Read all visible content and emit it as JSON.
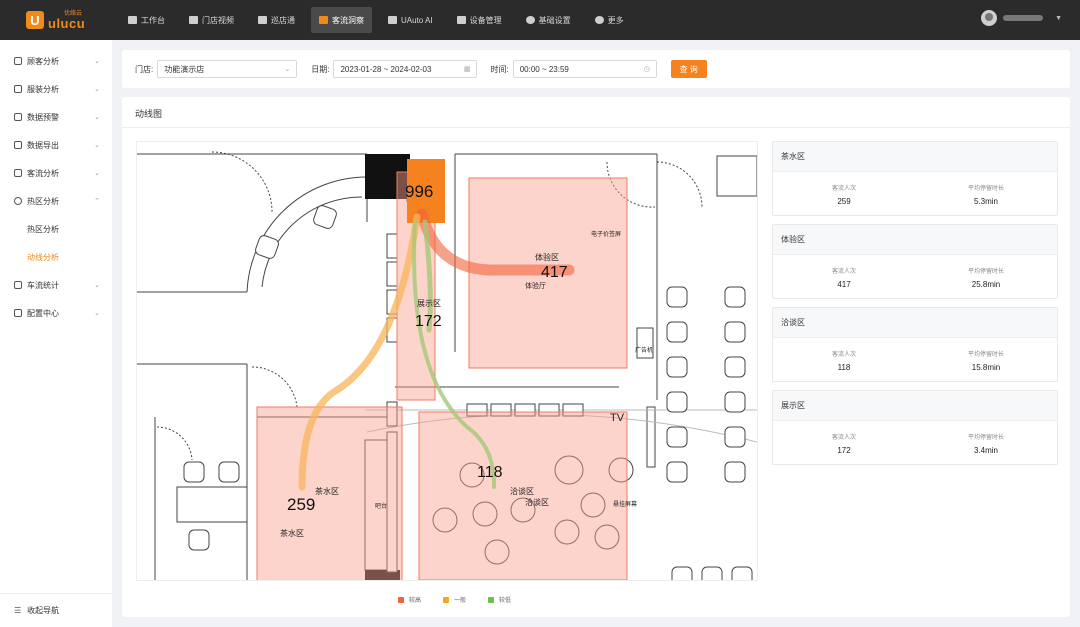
{
  "brand": {
    "name_cn": "优络云",
    "name_en": "ulucu",
    "color": "#f08a1b"
  },
  "topnav": [
    {
      "label": "工作台",
      "icon": "home-icon"
    },
    {
      "label": "门店视频",
      "icon": "video-icon"
    },
    {
      "label": "巡店通",
      "icon": "checklist-icon"
    },
    {
      "label": "客流洞察",
      "icon": "people-icon",
      "active": true
    },
    {
      "label": "UAuto AI",
      "icon": "ai-icon"
    },
    {
      "label": "设备管理",
      "icon": "device-icon"
    },
    {
      "label": "基础设置",
      "icon": "settings-icon"
    },
    {
      "label": "更多",
      "icon": "more-icon"
    }
  ],
  "sidebar": {
    "items": [
      {
        "label": "顾客分析",
        "icon": "user-icon"
      },
      {
        "label": "服装分析",
        "icon": "shirt-icon"
      },
      {
        "label": "数据预警",
        "icon": "bell-icon"
      },
      {
        "label": "数据导出",
        "icon": "export-icon"
      },
      {
        "label": "客流分析",
        "icon": "people-icon"
      },
      {
        "label": "热区分析",
        "icon": "target-icon"
      }
    ],
    "sub_items": [
      {
        "label": "热区分析"
      },
      {
        "label": "动线分析",
        "active": true
      }
    ],
    "items_after": [
      {
        "label": "车流统计",
        "icon": "car-icon"
      },
      {
        "label": "配置中心",
        "icon": "config-icon"
      }
    ],
    "collapse_label": "收起导航"
  },
  "filter": {
    "store_label": "门店:",
    "store_value": "功能演示店",
    "date_label": "日期:",
    "date_value": "2023-01-28  ~  2024-02-03",
    "time_label": "时间:",
    "time_value": "00:00  ~  23:59",
    "query_label": "查 询"
  },
  "panel": {
    "title": "动线图"
  },
  "map": {
    "entrance_count": "996",
    "zones": [
      {
        "name": "体验区",
        "count": "417",
        "sub_label": "体验厅"
      },
      {
        "name": "展示区",
        "count": "172"
      },
      {
        "name": "洽谈区",
        "count": "118",
        "sub_label": "洽谈区"
      },
      {
        "name": "茶水区",
        "count": "259",
        "sub_label": "茶水区"
      }
    ],
    "labels": {
      "tv": "TV",
      "ad": "广告机",
      "sign1": "电子价签屏",
      "sign2": "悬挂屏幕",
      "counter": "吧台"
    }
  },
  "legend": [
    {
      "label": "较高",
      "color": "#f4623a"
    },
    {
      "label": "一般",
      "color": "#f5a623"
    },
    {
      "label": "较低",
      "color": "#6fbf4a"
    }
  ],
  "stats_labels": {
    "visits": "客流人次",
    "dwell": "平均停留时长"
  },
  "zone_cards": [
    {
      "name": "茶水区",
      "visits": "259",
      "dwell": "5.3min"
    },
    {
      "name": "体验区",
      "visits": "417",
      "dwell": "25.8min"
    },
    {
      "name": "洽谈区",
      "visits": "118",
      "dwell": "15.8min"
    },
    {
      "name": "展示区",
      "visits": "172",
      "dwell": "3.4min"
    }
  ]
}
